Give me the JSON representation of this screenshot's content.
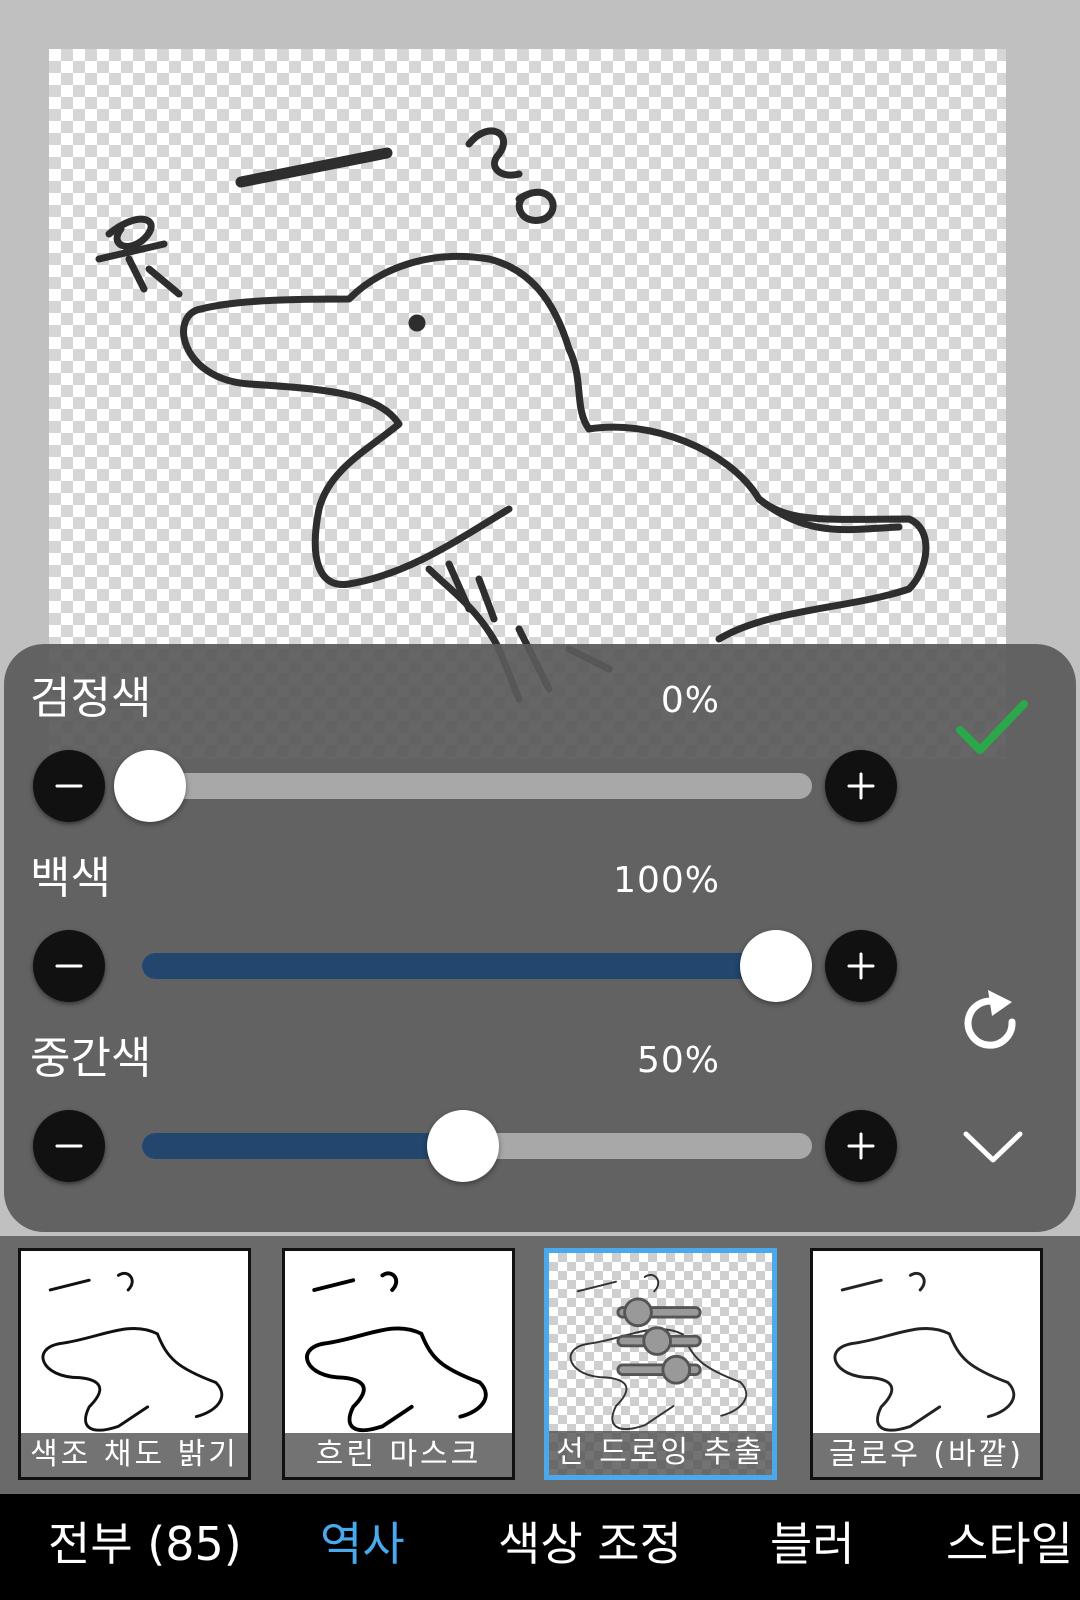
{
  "sliders": [
    {
      "label": "검정색",
      "value_text": "0%",
      "value": 0
    },
    {
      "label": "백색",
      "value_text": "100%",
      "value": 100
    },
    {
      "label": "중간색",
      "value_text": "50%",
      "value": 50
    }
  ],
  "presets": [
    {
      "label": "색조 채도 밝기",
      "selected": false
    },
    {
      "label": "흐린 마스크",
      "selected": false
    },
    {
      "label": "선 드로잉 추출",
      "selected": true
    },
    {
      "label": "글로우 (바깥)",
      "selected": false
    }
  ],
  "categories": [
    {
      "label": "전부 (85)",
      "active": false
    },
    {
      "label": "역사",
      "active": true
    },
    {
      "label": "색상 조정",
      "active": false
    },
    {
      "label": "블러",
      "active": false
    },
    {
      "label": "스타일",
      "active": false
    }
  ],
  "icons": {
    "confirm": "check-icon",
    "reset": "refresh-icon",
    "collapse": "chevron-down-icon",
    "decrease": "minus-icon",
    "increase": "plus-icon"
  },
  "colors": {
    "accent": "#4aa8ec",
    "slider_fill": "#23466e",
    "confirm": "#2aa84a"
  }
}
